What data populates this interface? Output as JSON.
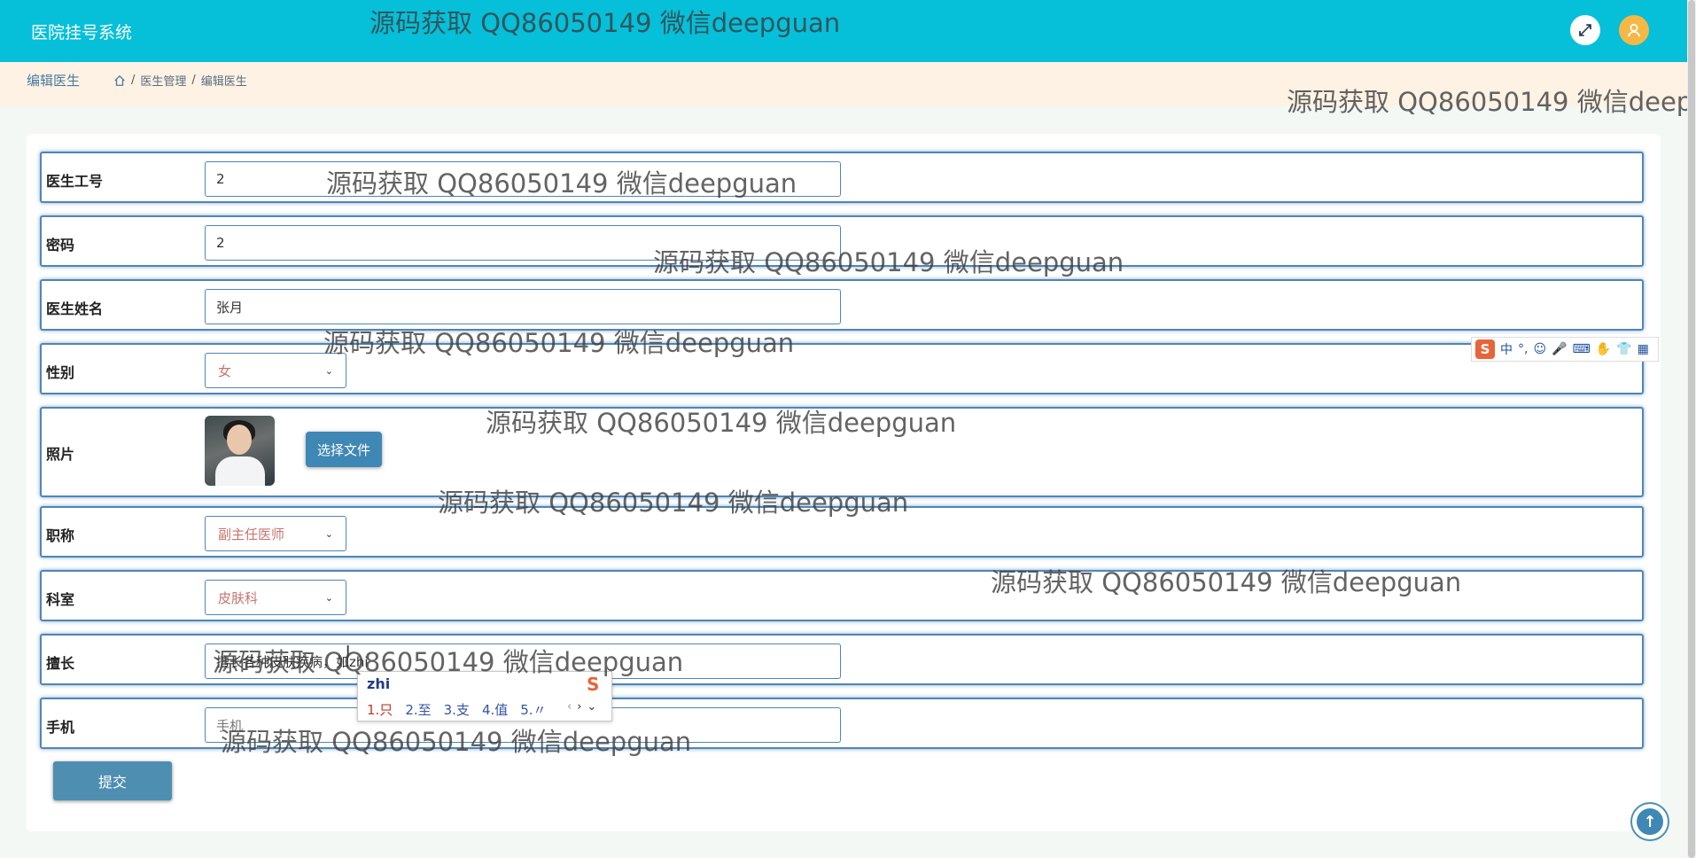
{
  "app": {
    "title": "医院挂号系统"
  },
  "breadcrumb": {
    "page_title": "编辑医生",
    "items": [
      "医生管理",
      "编辑医生"
    ],
    "separator": "/"
  },
  "form": {
    "fields": {
      "doctor_id": {
        "label": "医生工号",
        "value": "2"
      },
      "password": {
        "label": "密码",
        "value": "2"
      },
      "doctor_name": {
        "label": "医生姓名",
        "value": "张月"
      },
      "gender": {
        "label": "性别",
        "value": "女"
      },
      "photo": {
        "label": "照片",
        "button_label": "选择文件"
      },
      "title": {
        "label": "职称",
        "value": "副主任医师"
      },
      "department": {
        "label": "科室",
        "value": "皮肤科"
      },
      "specialty": {
        "label": "擅长",
        "value": "擅长各种皮肤疾病，如zhi"
      },
      "phone": {
        "label": "手机",
        "placeholder": "手机"
      }
    },
    "submit_label": "提交"
  },
  "ime": {
    "typed": "zhi",
    "candidates": [
      "1.只",
      "2.至",
      "3.支",
      "4.值",
      "5.〃"
    ],
    "toolbar": [
      "中",
      "°,",
      "☺",
      "🎤",
      "⌨",
      "✋",
      "👕",
      "▦"
    ]
  },
  "watermark": "源码获取 QQ86050149 微信deepguan",
  "icons": {
    "fullscreen": "fullscreen-icon",
    "user": "user-icon",
    "home": "home-icon",
    "scroll_top": "arrow-up-icon"
  },
  "colors": {
    "header": "#06bfd9",
    "breadcrumb_bg": "#fdf2e4",
    "primary": "#3f87b4",
    "select_text": "#c7756d"
  }
}
